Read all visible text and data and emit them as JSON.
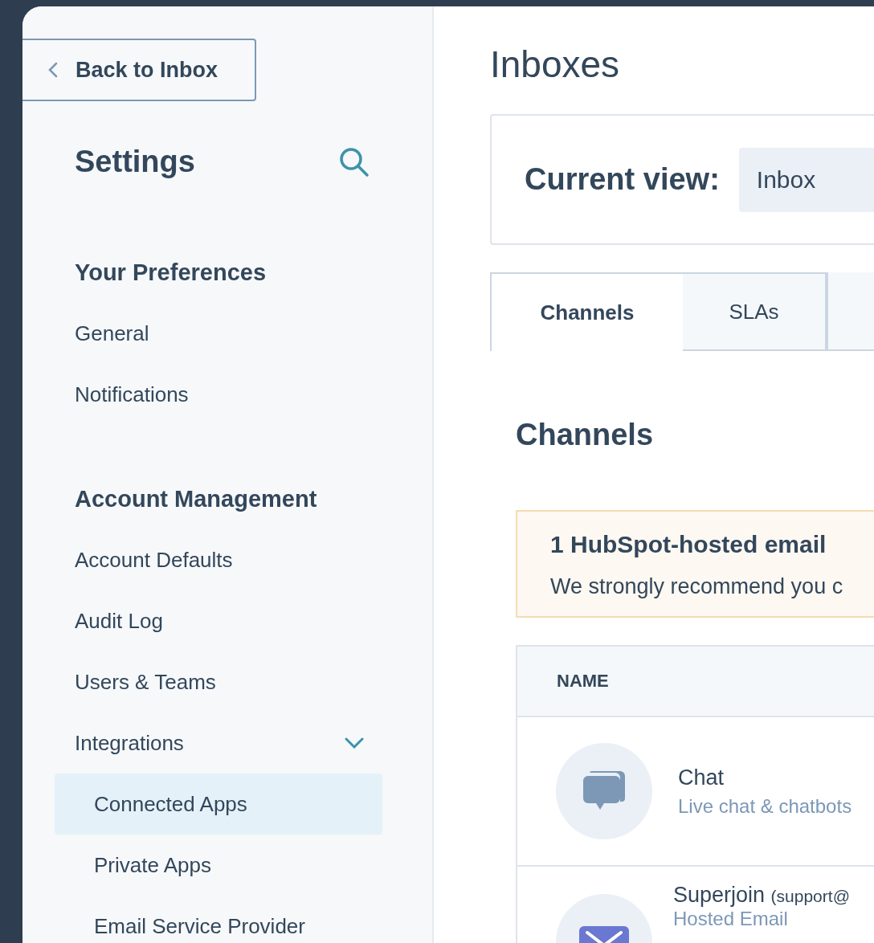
{
  "back_button": {
    "label": "Back to Inbox"
  },
  "sidebar": {
    "title": "Settings",
    "sections": [
      {
        "heading": "Your Preferences",
        "items": [
          {
            "label": "General",
            "selected": false
          },
          {
            "label": "Notifications",
            "selected": false
          }
        ]
      },
      {
        "heading": "Account Management",
        "items": [
          {
            "label": "Account Defaults",
            "selected": false
          },
          {
            "label": "Audit Log",
            "selected": false
          },
          {
            "label": "Users & Teams",
            "selected": false
          },
          {
            "label": "Integrations",
            "selected": false,
            "expanded": true,
            "children": [
              {
                "label": "Connected Apps",
                "selected": true
              },
              {
                "label": "Private Apps",
                "selected": false
              },
              {
                "label": "Email Service Provider",
                "selected": false
              }
            ]
          }
        ]
      }
    ]
  },
  "main": {
    "title": "Inboxes",
    "current_view": {
      "label": "Current view:",
      "value": "Inbox"
    },
    "tabs": [
      {
        "label": "Channels",
        "selected": true
      },
      {
        "label": "SLAs",
        "selected": false
      }
    ],
    "section_title": "Channels",
    "alert": {
      "title": "1 HubSpot-hosted email",
      "text": "We strongly recommend you c"
    },
    "table": {
      "columns": [
        "NAME"
      ],
      "rows": [
        {
          "kind": "chat",
          "name": "Chat",
          "detail": "Live chat & chatbots"
        },
        {
          "kind": "email",
          "name": "Superjoin",
          "address": "(support@",
          "detail": "Hosted Email"
        }
      ]
    }
  }
}
